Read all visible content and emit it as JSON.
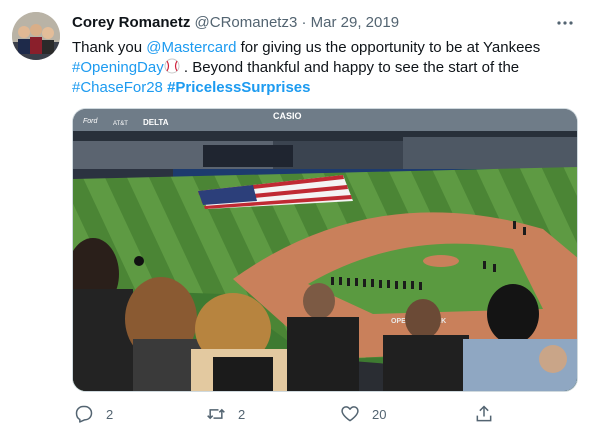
{
  "tweet": {
    "display_name": "Corey Romanetz",
    "handle": "@CRomanetz3",
    "separator": "·",
    "date": "Mar 29, 2019",
    "more_icon": "more-dots-icon",
    "text": {
      "t1": "Thank you ",
      "mention": "@Mastercard",
      "t2": " for giving us the opportunity to be at Yankees",
      "hashtag1": "#OpeningDay",
      "t3": " . Beyond thankful and happy to see the start of the",
      "hashtag2": "#ChaseFor28",
      "hashtag3": "#PricelessSurprises"
    },
    "media_signs": {
      "casio": "CASIO",
      "delta": "DELTA",
      "att": "AT&T",
      "ford": "Ford",
      "opening_week": "OPENING WEEK"
    },
    "actions": {
      "reply_count": "2",
      "retweet_count": "2",
      "like_count": "20"
    },
    "colors": {
      "link": "#1d9bf0",
      "secondary_text": "#536471",
      "grass": "#4f8f3a",
      "dirt": "#c9805b"
    }
  }
}
